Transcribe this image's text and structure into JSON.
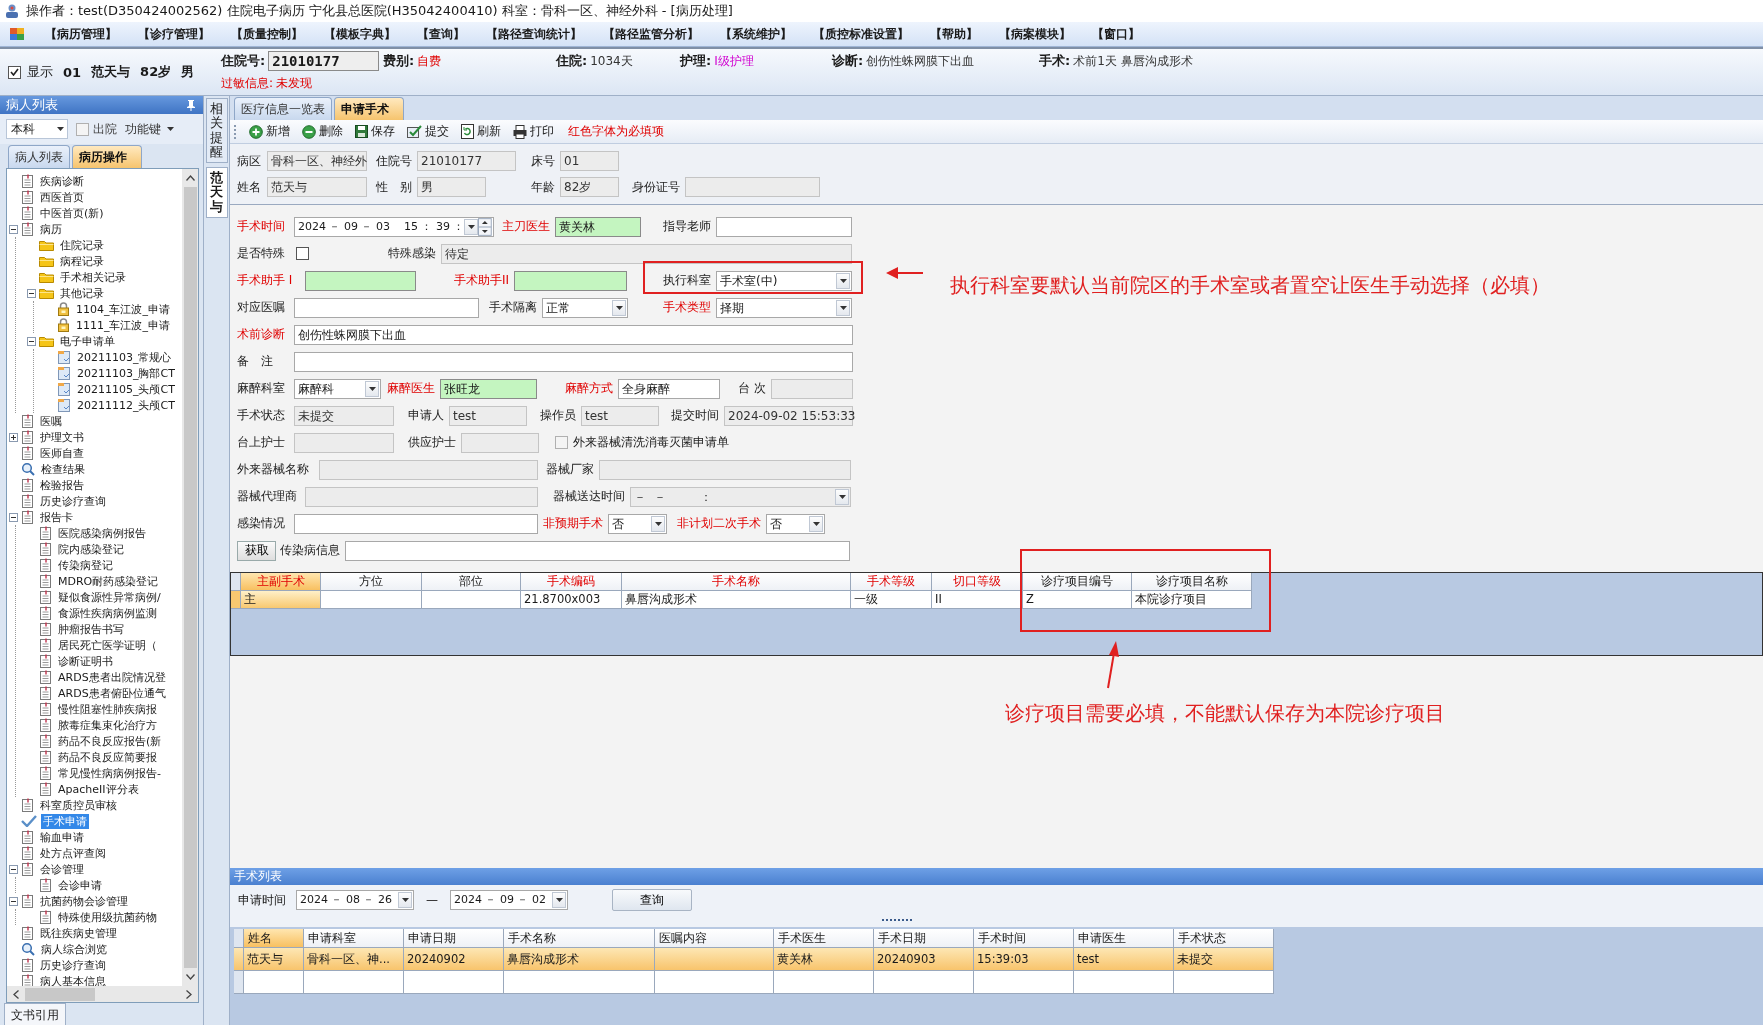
{
  "window": {
    "title": "操作者：test(D350424002562) 住院电子病历  宁化县总医院(H35042400410)  科室：骨科一区、神经外科 - [病历处理]"
  },
  "menu": [
    "【病历管理】",
    "【诊疗管理】",
    "【质量控制】",
    "【模板字典】",
    "【查询】",
    "【路径查询统计】",
    "【路径监管分析】",
    "【系统维护】",
    "【质控标准设置】",
    "【帮助】",
    "【病案模块】",
    "【窗口】"
  ],
  "patient_bar": {
    "show": {
      "label": "显示",
      "checked": true
    },
    "bed": "01",
    "name": "范天与",
    "age": "82岁",
    "sex": "男",
    "fields": [
      {
        "label": "住院号:",
        "value": "21010177",
        "kind": "box"
      },
      {
        "label": "费别:",
        "value": "自费",
        "kind": "alert"
      },
      {
        "label": "住院:",
        "value": "1034天",
        "kind": "text"
      },
      {
        "label": "护理:",
        "value": "I级护理",
        "kind": "care"
      },
      {
        "label": "诊断:",
        "value": "创伤性蛛网膜下出血",
        "kind": "text"
      },
      {
        "label": "手术:",
        "value": "术前1天  鼻唇沟成形术",
        "kind": "text"
      }
    ],
    "allergy": {
      "label": "过敏信息:",
      "value": "未发现"
    }
  },
  "sidebar": {
    "title": "病人列表",
    "scope": "本科",
    "discharged": {
      "label": "出院",
      "checked": false
    },
    "function_key": "功能键",
    "tabs": [
      {
        "label": "病人列表",
        "selected": false
      },
      {
        "label": "病历操作",
        "selected": true
      }
    ],
    "tree": [
      {
        "text": "疾病诊断",
        "kind": "document",
        "selected": false
      },
      {
        "text": "西医首页",
        "kind": "document",
        "selected": false
      },
      {
        "text": "中医首页(新)",
        "kind": "document",
        "selected": false
      },
      {
        "text": "病历",
        "kind": "document",
        "selected": false,
        "expanded": true,
        "children": [
          {
            "text": "住院记录",
            "kind": "folder",
            "selected": false
          },
          {
            "text": "病程记录",
            "kind": "folder",
            "selected": false
          },
          {
            "text": "手术相关记录",
            "kind": "folder",
            "selected": false
          },
          {
            "text": "其他记录",
            "kind": "folder",
            "selected": false,
            "expanded": true,
            "children": [
              {
                "text": "1104_车江波_申请",
                "kind": "locked",
                "selected": false
              },
              {
                "text": "1111_车江波_申请",
                "kind": "locked",
                "selected": false
              }
            ]
          },
          {
            "text": "电子申请单",
            "kind": "folder",
            "selected": false,
            "expanded": true,
            "children": [
              {
                "text": "20211103_常规心",
                "kind": "file",
                "selected": false
              },
              {
                "text": "20211103_胸部CT",
                "kind": "file",
                "selected": false
              },
              {
                "text": "20211105_头颅CT",
                "kind": "file",
                "selected": false
              },
              {
                "text": "20211112_头颅CT",
                "kind": "file",
                "selected": false
              }
            ]
          }
        ]
      },
      {
        "text": "医嘱",
        "kind": "document",
        "selected": false
      },
      {
        "text": "护理文书",
        "kind": "document",
        "selected": false,
        "expanded": false
      },
      {
        "text": "医师自查",
        "kind": "document",
        "selected": false
      },
      {
        "text": "检查结果",
        "kind": "magnifier",
        "selected": false
      },
      {
        "text": "检验报告",
        "kind": "document",
        "selected": false
      },
      {
        "text": "历史诊疗查询",
        "kind": "document",
        "selected": false
      },
      {
        "text": "报告卡",
        "kind": "document",
        "selected": false,
        "expanded": true,
        "children": [
          {
            "text": "医院感染病例报告",
            "kind": "document",
            "selected": false
          },
          {
            "text": "院内感染登记",
            "kind": "document",
            "selected": false
          },
          {
            "text": "传染病登记",
            "kind": "document",
            "selected": false
          },
          {
            "text": "MDRO耐药感染登记",
            "kind": "document",
            "selected": false
          },
          {
            "text": "疑似食源性异常病例/",
            "kind": "document",
            "selected": false
          },
          {
            "text": "食源性疾病病例监测",
            "kind": "document",
            "selected": false
          },
          {
            "text": "肿瘤报告书写",
            "kind": "document",
            "selected": false
          },
          {
            "text": "居民死亡医学证明（",
            "kind": "document",
            "selected": false
          },
          {
            "text": "诊断证明书",
            "kind": "document",
            "selected": false
          },
          {
            "text": "ARDS患者出院情况登",
            "kind": "document",
            "selected": false
          },
          {
            "text": "ARDS患者俯卧位通气",
            "kind": "document",
            "selected": false
          },
          {
            "text": "慢性阻塞性肺疾病报",
            "kind": "document",
            "selected": false
          },
          {
            "text": "脓毒症集束化治疗方",
            "kind": "document",
            "selected": false
          },
          {
            "text": "药品不良反应报告(新",
            "kind": "document",
            "selected": false
          },
          {
            "text": "药品不良反应简要报",
            "kind": "document",
            "selected": false
          },
          {
            "text": "常见慢性病病例报告-",
            "kind": "document",
            "selected": false
          },
          {
            "text": "ApacheII评分表",
            "kind": "document",
            "selected": false
          }
        ]
      },
      {
        "text": "科室质控员审核",
        "kind": "document",
        "selected": false
      },
      {
        "text": "手术申请",
        "kind": "checkmark",
        "selected": true
      },
      {
        "text": "输血申请",
        "kind": "document",
        "selected": false
      },
      {
        "text": "处方点评查阅",
        "kind": "document",
        "selected": false
      },
      {
        "text": "会诊管理",
        "kind": "document",
        "selected": false,
        "expanded": true,
        "children": [
          {
            "text": "会诊申请",
            "kind": "document",
            "selected": false
          }
        ]
      },
      {
        "text": "抗菌药物会诊管理",
        "kind": "document",
        "selected": false,
        "expanded": true,
        "children": [
          {
            "text": "特殊使用级抗菌药物",
            "kind": "document",
            "selected": false
          }
        ]
      },
      {
        "text": "既往疾病史管理",
        "kind": "document",
        "selected": false
      },
      {
        "text": "病人综合浏览",
        "kind": "magnifier",
        "selected": false
      },
      {
        "text": "历史诊疗查询",
        "kind": "document",
        "selected": false
      },
      {
        "text": "病人基本信息",
        "kind": "document",
        "selected": false
      }
    ],
    "bottom_tab": "文书引用"
  },
  "side_tabs": [
    {
      "label": "相关提醒",
      "selected": false
    },
    {
      "label": "范天与",
      "selected": true
    }
  ],
  "tabs": [
    {
      "label": "医疗信息一览表",
      "selected": false
    },
    {
      "label": "申请手术",
      "selected": true
    }
  ],
  "toolbar": [
    {
      "label": "新增",
      "kind": "add"
    },
    {
      "label": "删除",
      "kind": "delete"
    },
    {
      "label": "保存",
      "kind": "save"
    },
    {
      "label": "提交",
      "kind": "submit"
    },
    {
      "label": "刷新",
      "kind": "refresh"
    },
    {
      "label": "打印",
      "kind": "print"
    }
  ],
  "toolbar_note": "红色字体为必填项",
  "info": {
    "rows": [
      {
        "items": [
          {
            "kind": "label",
            "text": "病区"
          },
          {
            "kind": "field",
            "value": "骨科一区、神经外",
            "disabled": true
          },
          {
            "kind": "label",
            "text": "住院号"
          },
          {
            "kind": "field",
            "value": "21010177",
            "disabled": true
          },
          {
            "kind": "label",
            "text": "床号"
          },
          {
            "kind": "field",
            "value": "01",
            "disabled": true
          }
        ]
      },
      {
        "items": [
          {
            "kind": "label",
            "text": "姓名"
          },
          {
            "kind": "field",
            "value": "范天与",
            "disabled": true
          },
          {
            "kind": "label",
            "text": "性　别"
          },
          {
            "kind": "field",
            "value": "男",
            "disabled": true
          },
          {
            "kind": "label",
            "text": "年龄"
          },
          {
            "kind": "field",
            "value": "82岁",
            "disabled": true
          },
          {
            "kind": "label",
            "text": "身份证号"
          },
          {
            "kind": "field",
            "disabled": true
          }
        ]
      }
    ]
  },
  "form": {
    "rows": [
      {
        "items": [
          {
            "kind": "label",
            "text": "手术时间",
            "required": true
          },
          {
            "kind": "datetime",
            "value": "2024 － 09 － 03    15 ： 39 ："
          },
          {
            "kind": "label",
            "text": "主刀医生",
            "required": true
          },
          {
            "kind": "field",
            "value": "黄关林",
            "highlighted": true
          },
          {
            "kind": "label",
            "text": "指导老师"
          },
          {
            "kind": "field"
          }
        ]
      },
      {
        "items": [
          {
            "kind": "label",
            "text": "是否特殊"
          },
          {
            "kind": "check",
            "checked": false
          },
          {
            "kind": "label",
            "text": "特殊感染"
          },
          {
            "kind": "field",
            "value": "待定",
            "disabled": true
          }
        ]
      },
      {
        "items": [
          {
            "kind": "label",
            "text": "手术助手 I",
            "required": true
          },
          {
            "kind": "field",
            "highlighted": true
          },
          {
            "kind": "label",
            "text": "手术助手II",
            "required": true
          },
          {
            "kind": "field",
            "highlighted": true
          },
          {
            "kind": "label",
            "text": "执行科室"
          },
          {
            "kind": "combo",
            "value": "手术室(中)"
          }
        ]
      },
      {
        "items": [
          {
            "kind": "label",
            "text": "对应医嘱"
          },
          {
            "kind": "field"
          },
          {
            "kind": "label",
            "text": "手术隔离"
          },
          {
            "kind": "combo",
            "value": "正常"
          },
          {
            "kind": "label",
            "text": "手术类型",
            "required": true
          },
          {
            "kind": "combo",
            "value": "择期"
          }
        ]
      },
      {
        "items": [
          {
            "kind": "label",
            "text": "术前诊断",
            "required": true
          },
          {
            "kind": "field",
            "value": "创伤性蛛网膜下出血"
          }
        ]
      },
      {
        "items": [
          {
            "kind": "label",
            "text": "备　注"
          },
          {
            "kind": "field"
          }
        ]
      },
      {
        "items": [
          {
            "kind": "label",
            "text": "麻醉科室"
          },
          {
            "kind": "combo",
            "value": "麻醉科"
          },
          {
            "kind": "label",
            "text": "麻醉医生",
            "required": true
          },
          {
            "kind": "field",
            "value": "张旺龙",
            "highlighted": true
          },
          {
            "kind": "label",
            "text": "麻醉方式",
            "required": true
          },
          {
            "kind": "field",
            "value": "全身麻醉"
          },
          {
            "kind": "label",
            "text": "台 次"
          },
          {
            "kind": "field",
            "disabled": true
          }
        ]
      },
      {
        "items": [
          {
            "kind": "label",
            "text": "手术状态"
          },
          {
            "kind": "field",
            "value": "未提交",
            "disabled": true
          },
          {
            "kind": "label",
            "text": "申请人"
          },
          {
            "kind": "field",
            "value": "test",
            "disabled": true
          },
          {
            "kind": "label",
            "text": "操作员"
          },
          {
            "kind": "field",
            "value": "test",
            "disabled": true
          },
          {
            "kind": "label",
            "text": "提交时间"
          },
          {
            "kind": "field",
            "value": "2024-09-02 15:53:33",
            "disabled": true
          }
        ]
      },
      {
        "items": [
          {
            "kind": "label",
            "text": "台上护士"
          },
          {
            "kind": "field",
            "disabled": true
          },
          {
            "kind": "label",
            "text": "供应护士"
          },
          {
            "kind": "field",
            "disabled": true
          },
          {
            "kind": "check",
            "checked": false,
            "disabled": true,
            "label": "外来器械清洗消毒灭菌申请单"
          }
        ]
      },
      {
        "items": [
          {
            "kind": "label",
            "text": "外来器械名称"
          },
          {
            "kind": "field",
            "disabled": true
          },
          {
            "kind": "label",
            "text": "器械厂家"
          },
          {
            "kind": "field",
            "disabled": true
          }
        ]
      },
      {
        "items": [
          {
            "kind": "label",
            "text": "器械代理商"
          },
          {
            "kind": "field",
            "disabled": true
          },
          {
            "kind": "label",
            "text": "器械送达时间"
          },
          {
            "kind": "combo",
            "value": "－  －         ：",
            "disabled": true
          }
        ]
      },
      {
        "items": [
          {
            "kind": "label",
            "text": "感染情况"
          },
          {
            "kind": "field"
          },
          {
            "kind": "label",
            "text": "非预期手术",
            "required": true
          },
          {
            "kind": "combo",
            "value": "否"
          },
          {
            "kind": "label",
            "text": "非计划二次手术",
            "required": true
          },
          {
            "kind": "combo",
            "value": "否"
          }
        ]
      },
      {
        "items": [
          {
            "kind": "button",
            "text": "获取"
          },
          {
            "kind": "label",
            "text": "传染病信息"
          },
          {
            "kind": "field"
          }
        ]
      }
    ]
  },
  "surgery_grid": {
    "columns": [
      {
        "label": "主副手术",
        "required": true
      },
      {
        "label": "方位",
        "required": false
      },
      {
        "label": "部位",
        "required": false
      },
      {
        "label": "手术编码",
        "required": true
      },
      {
        "label": "手术名称",
        "required": true
      },
      {
        "label": "手术等级",
        "required": true
      },
      {
        "label": "切口等级",
        "required": true
      },
      {
        "label": "诊疗项目编号",
        "required": false
      },
      {
        "label": "诊疗项目名称",
        "required": false
      }
    ],
    "rows": [
      {
        "selected": true,
        "cells": [
          "主",
          null,
          null,
          "21.8700x003",
          "鼻唇沟成形术",
          "一级",
          "II",
          "Z",
          "本院诊疗项目"
        ]
      }
    ]
  },
  "surgery_list": {
    "title": "手术列表",
    "filter": {
      "label": "申请时间",
      "from": "2024 － 08 － 26",
      "separator": "—",
      "to": "2024 － 09 － 02",
      "button": "查询"
    },
    "columns": [
      "姓名",
      "申请科室",
      "申请日期",
      "手术名称",
      "医嘱内容",
      "手术医生",
      "手术日期",
      "手术时间",
      "申请医生",
      "手术状态"
    ],
    "rows": [
      {
        "selected": true,
        "cells": [
          "范天与",
          "骨科一区、神...",
          "20240902",
          "鼻唇沟成形术",
          null,
          "黄关林",
          "20240903",
          "15:39:03",
          "test",
          "未提交"
        ]
      }
    ]
  },
  "annotations": [
    {
      "text": "执行科室要默认当前院区的手术室或者置空让医生手动选择（必填）"
    },
    {
      "text": "诊疗项目需要必填，不能默认保存为本院诊疗项目"
    }
  ]
}
